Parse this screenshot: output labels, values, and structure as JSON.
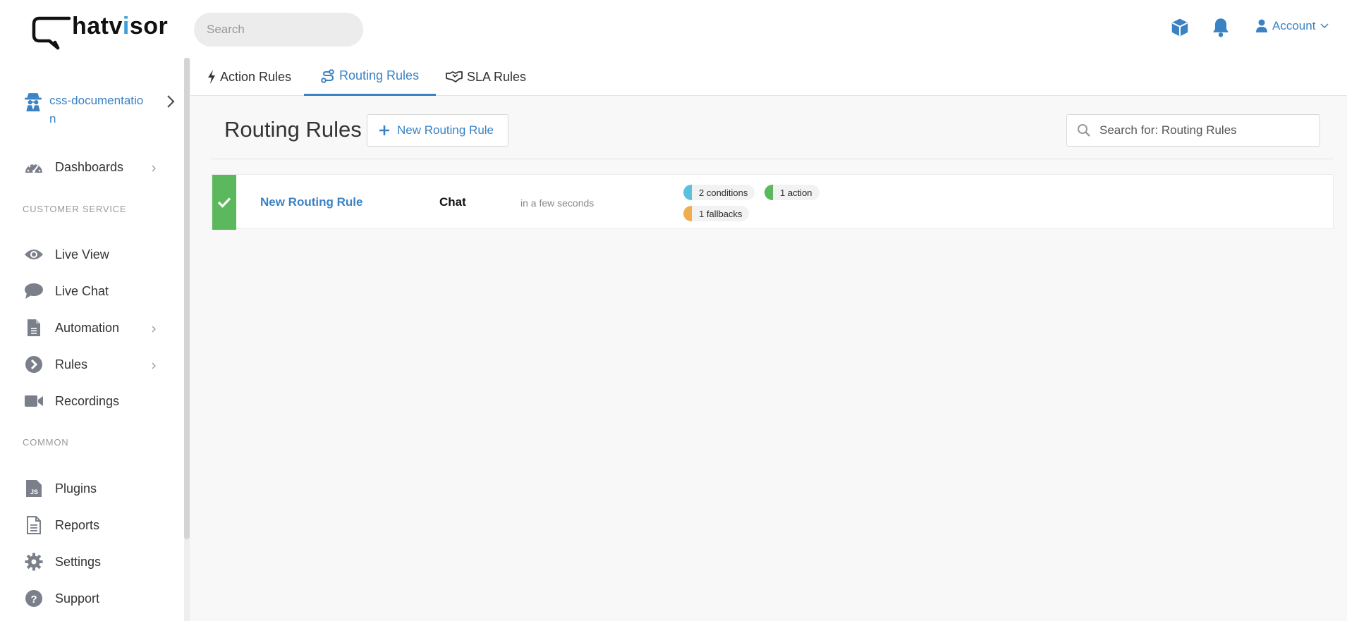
{
  "header": {
    "logo_text_prefix": "hatv",
    "logo_text_accent": "i",
    "logo_text_suffix": "sor",
    "search_placeholder": "Search",
    "account_label": "Account"
  },
  "sidebar": {
    "org_name": "css-documentation",
    "items_top": [
      {
        "label": "Dashboards",
        "icon": "gauge-icon",
        "has_chevron": true
      }
    ],
    "section_customer_service": "CUSTOMER SERVICE",
    "items_cs": [
      {
        "label": "Live View",
        "icon": "eye-icon",
        "has_chevron": false
      },
      {
        "label": "Live Chat",
        "icon": "chat-bubble-icon",
        "has_chevron": false
      },
      {
        "label": "Automation",
        "icon": "document-icon",
        "has_chevron": true
      },
      {
        "label": "Rules",
        "icon": "chevron-circle-icon",
        "has_chevron": true
      },
      {
        "label": "Recordings",
        "icon": "video-camera-icon",
        "has_chevron": false
      }
    ],
    "section_common": "COMMON",
    "items_common": [
      {
        "label": "Plugins",
        "icon": "js-file-icon"
      },
      {
        "label": "Reports",
        "icon": "report-icon"
      },
      {
        "label": "Settings",
        "icon": "gear-icon"
      },
      {
        "label": "Support",
        "icon": "question-circle-icon"
      }
    ]
  },
  "tabs": [
    {
      "label": "Action Rules",
      "icon": "bolt-icon",
      "active": false
    },
    {
      "label": "Routing Rules",
      "icon": "route-icon",
      "active": true
    },
    {
      "label": "SLA Rules",
      "icon": "handshake-icon",
      "active": false
    }
  ],
  "main": {
    "title": "Routing Rules",
    "new_button_label": "New Routing Rule",
    "search_placeholder": "Search for: Routing Rules",
    "rules": [
      {
        "name": "New Routing Rule",
        "channel": "Chat",
        "time": "in a few seconds",
        "status": "active",
        "badges": [
          {
            "label": "2 conditions",
            "color": "#5bc0de"
          },
          {
            "label": "1 action",
            "color": "#5cb85c"
          },
          {
            "label": "1 fallbacks",
            "color": "#f0ad4e"
          }
        ]
      }
    ]
  },
  "colors": {
    "accent": "#3a82c4",
    "success": "#5cb85c",
    "icon_gray": "#7a7f8a"
  }
}
